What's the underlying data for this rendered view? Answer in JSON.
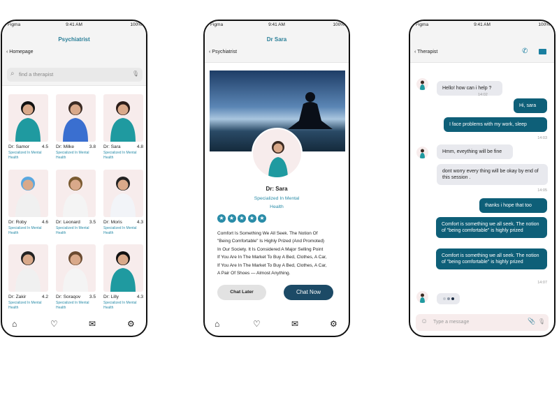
{
  "status": {
    "carrier": "Figma",
    "time": "9:41 AM",
    "battery": "100%"
  },
  "colors": {
    "teal": "#2a8ca8",
    "bubble_out": "#0e5f78",
    "chat_now": "#1c4a66",
    "card_bg": "#f7ecec"
  },
  "list_screen": {
    "title": "Psychiatrist",
    "back": "Homepage",
    "search_placeholder": "find a therapist",
    "doctors": [
      {
        "name": "Dr: Samor",
        "rating": "4.5",
        "spec": "Specialized In Mental Health"
      },
      {
        "name": "Dr: Milke",
        "rating": "3.8",
        "spec": "Specialized In Mental Health"
      },
      {
        "name": "Dr: Sara",
        "rating": "4.8",
        "spec": "Specialized In Mental Health"
      },
      {
        "name": "Dr: Roby",
        "rating": "4.6",
        "spec": "Specialized In Mental Health"
      },
      {
        "name": "Dr: Leonard",
        "rating": "3.5",
        "spec": "Specialized In Mental Health"
      },
      {
        "name": "Dr: Moris",
        "rating": "4.3",
        "spec": "Specialized In Mental Health"
      },
      {
        "name": "Dr: Zakir",
        "rating": "4.2",
        "spec": "Specialized In Mental Health"
      },
      {
        "name": "Dr: Soraqov",
        "rating": "3.5",
        "spec": "Specialized In Mental Health"
      },
      {
        "name": "Dr: Lilly",
        "rating": "4.3",
        "spec": "Specialized In Mental Health"
      }
    ],
    "nav": [
      "home-icon",
      "heart-icon",
      "messages-icon",
      "gear-icon"
    ]
  },
  "profile_screen": {
    "title": "Dr Sara",
    "back": "Psychiatrist",
    "name": "Dr: Sara",
    "spec_line1": "Specialized In Mental",
    "spec_line2": "Health",
    "stars": 5,
    "bio": [
      "Comfort Is Something We All Seek. The Notion Of",
      "\"Being Comfortable\" Is Highly Prized (And Promoted)",
      "In Our Society. It Is Considered A Major Selling Point",
      "If You Are In The Market To Buy A Bed, Clothes, A Car,",
      "If You Are In The Market To Buy A Bed, Clothes, A Car,",
      "A Pair Of Shoes — Almost Anything."
    ],
    "chat_later": "Chat Later",
    "chat_now": "Chat  Now"
  },
  "chat_screen": {
    "back": "Therapist",
    "input_placeholder": "Type a message",
    "messages": [
      {
        "from": "them",
        "text": "Hello! how can i help ?"
      },
      {
        "time": "14:02"
      },
      {
        "from": "me",
        "text": "Hi, sara"
      },
      {
        "from": "me",
        "text": "I face problems with my work, sleep"
      },
      {
        "time": "14:03"
      },
      {
        "from": "them",
        "text": "Hmm, eveything will be fine"
      },
      {
        "from": "them",
        "text": "dont worry every thing will be okay by end of this session ."
      },
      {
        "time": "14:05"
      },
      {
        "from": "me",
        "text": "thanks i hope that too"
      },
      {
        "from": "me",
        "text": "Comfort is something we all seek. The notion of \"being comfortable\" is highly prized"
      },
      {
        "from": "me",
        "text": "Comfort is something we all seek. The notion of \"being comfortable\" is highly prized"
      },
      {
        "time": "14:07"
      }
    ]
  }
}
